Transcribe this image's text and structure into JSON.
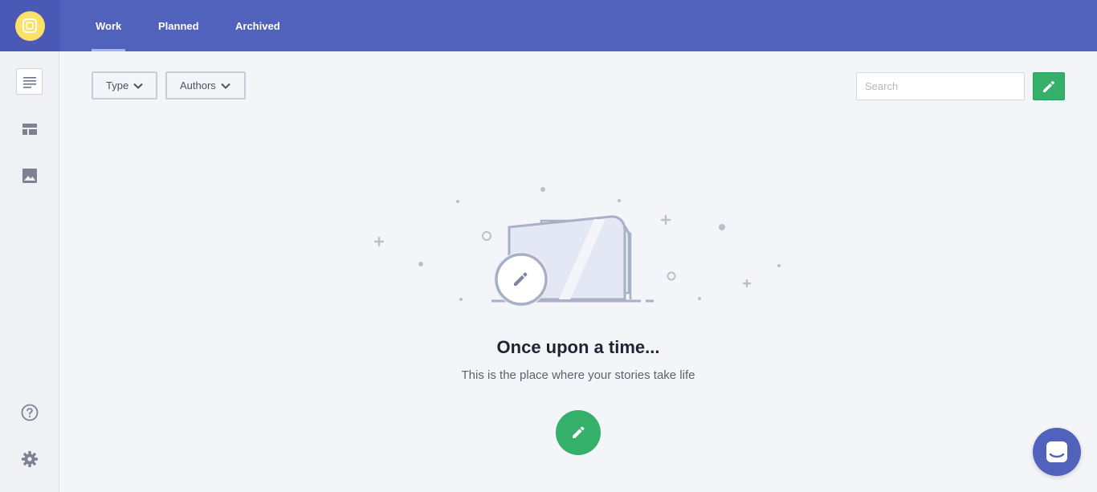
{
  "app": {
    "brand_color": "#5162bd",
    "accent_green": "#35b06a",
    "logo_color": "#fbe168"
  },
  "tabs": [
    {
      "label": "Work",
      "active": true
    },
    {
      "label": "Planned",
      "active": false
    },
    {
      "label": "Archived",
      "active": false
    }
  ],
  "sidebar": {
    "items": [
      {
        "icon": "stories-list-icon",
        "active": true
      },
      {
        "icon": "layout-icon",
        "active": false
      },
      {
        "icon": "image-icon",
        "active": false
      }
    ],
    "bottom": [
      {
        "icon": "help-icon"
      },
      {
        "icon": "gear-icon"
      }
    ]
  },
  "filters": {
    "type_label": "Type",
    "authors_label": "Authors"
  },
  "search": {
    "placeholder": "Search",
    "value": ""
  },
  "empty_state": {
    "title": "Once upon a time...",
    "subtitle": "This is the place where your stories take life"
  }
}
